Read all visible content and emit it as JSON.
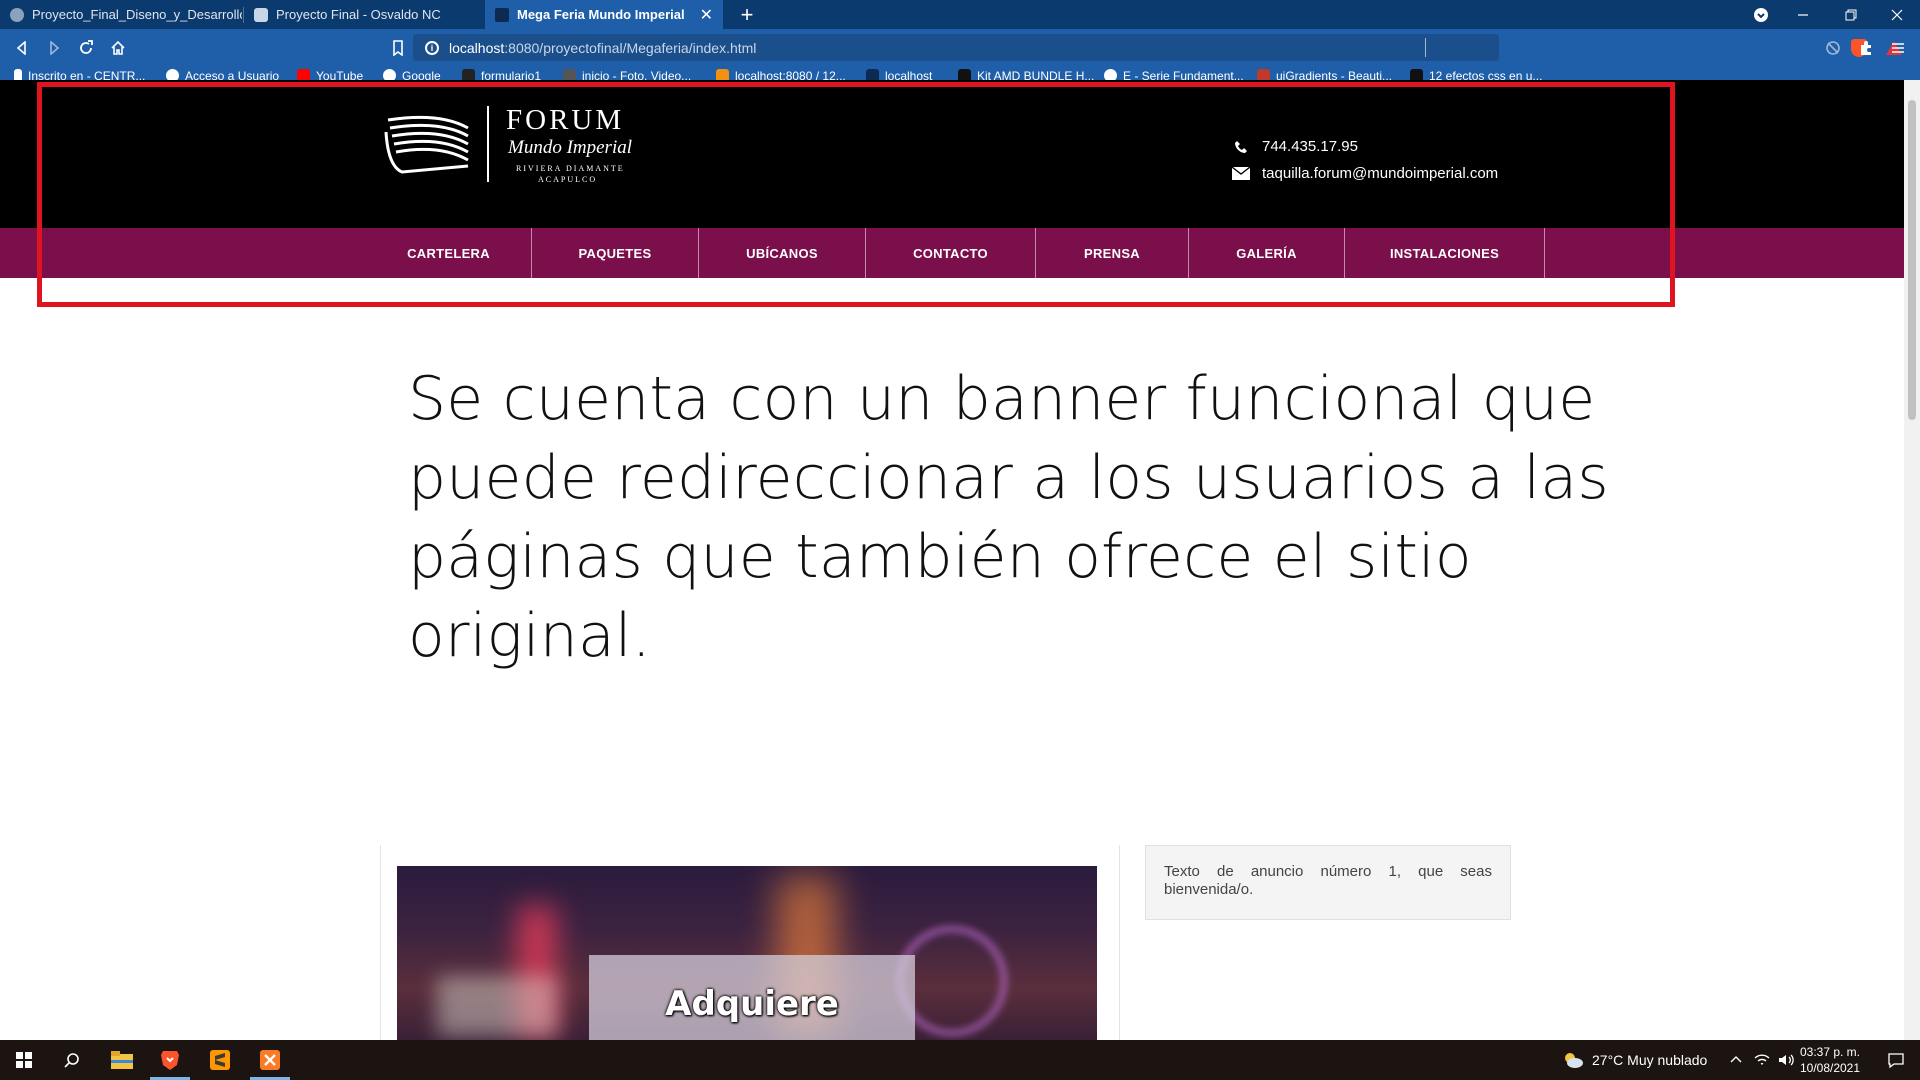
{
  "browser": {
    "tabs": [
      {
        "title": "Proyecto_Final_Diseno_y_Desarrollo_C",
        "active": false
      },
      {
        "title": "Proyecto Final - Osvaldo NC",
        "active": false
      },
      {
        "title": "Mega Feria Mundo Imperial",
        "active": true
      }
    ],
    "new_tab_label": "+",
    "url_host": "localhost",
    "url_rest": ":8080/proyectofinal/Megaferia/index.html",
    "bookmarks": [
      "Inscrito en - CENTR...",
      "Acceso a Usuario",
      "YouTube",
      "Google",
      "formulario1",
      "inicio - Foto, Video...",
      "localhost:8080 / 12...",
      "localhost",
      "Kit AMD BUNDLE H...",
      "E - Serie Fundament...",
      "uiGradients - Beauti...",
      "12 efectos css en u..."
    ]
  },
  "site": {
    "logo": {
      "name": "FORUM",
      "script": "Mundo Imperial",
      "line1": "RIVIERA DIAMANTE",
      "line2": "ACAPULCO"
    },
    "phone": "744.435.17.95",
    "email": "taquilla.forum@mundoimperial.com",
    "nav": [
      "CARTELERA",
      "PAQUETES",
      "UBÍCANOS",
      "CONTACTO",
      "PRENSA",
      "GALERÍA",
      "INSTALACIONES"
    ],
    "headline": "Se cuenta con un banner funcional que puede redireccionar a los usuarios a las páginas que también ofrece el sitio original.",
    "promo_text": "Adquiere",
    "ad_text": "Texto de anuncio número 1, que seas bienvenida/o."
  },
  "taskbar": {
    "weather": "27°C  Muy nublado",
    "time": "03:37 p. m.",
    "date": "10/08/2021"
  },
  "colors": {
    "nav_bg": "#7b0f4c",
    "header_bg": "#000000",
    "highlight": "#e0141e",
    "browser_bar": "#1f5ea8"
  }
}
